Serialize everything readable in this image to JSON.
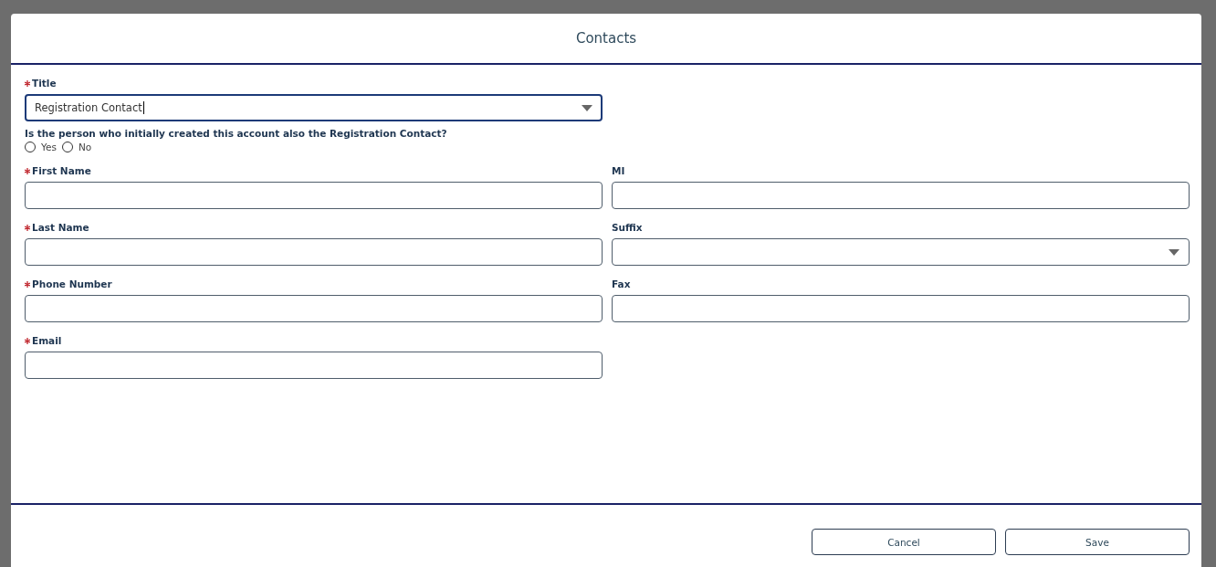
{
  "dialog": {
    "title": "Contacts",
    "rows": [
      {
        "kind": "fields",
        "fields": [
          {
            "label": "Title",
            "required": true,
            "kind": "select",
            "value": "Registration Contact",
            "focused": true
          }
        ]
      },
      {
        "kind": "radio-question",
        "question": "Is the person who initially created this account also the Registration Contact?",
        "options": [
          {
            "label": "Yes",
            "selected": false
          },
          {
            "label": "No",
            "selected": false
          }
        ]
      },
      {
        "kind": "fields",
        "fields": [
          {
            "label": "First Name",
            "required": true,
            "kind": "text",
            "focused": false
          },
          {
            "label": "MI",
            "required": false,
            "kind": "text",
            "focused": false
          }
        ]
      },
      {
        "kind": "fields",
        "fields": [
          {
            "label": "Last Name",
            "required": true,
            "kind": "text",
            "focused": false
          },
          {
            "label": "Suffix",
            "required": false,
            "kind": "select",
            "focused": false
          }
        ]
      },
      {
        "kind": "fields",
        "fields": [
          {
            "label": "Phone Number",
            "required": true,
            "kind": "text",
            "focused": false
          },
          {
            "label": "Fax",
            "required": false,
            "kind": "text",
            "focused": false
          }
        ]
      },
      {
        "kind": "fields",
        "fields": [
          {
            "label": "Email",
            "required": true,
            "kind": "text",
            "focused": false
          }
        ]
      }
    ],
    "buttons": [
      "Cancel",
      "Save"
    ]
  }
}
